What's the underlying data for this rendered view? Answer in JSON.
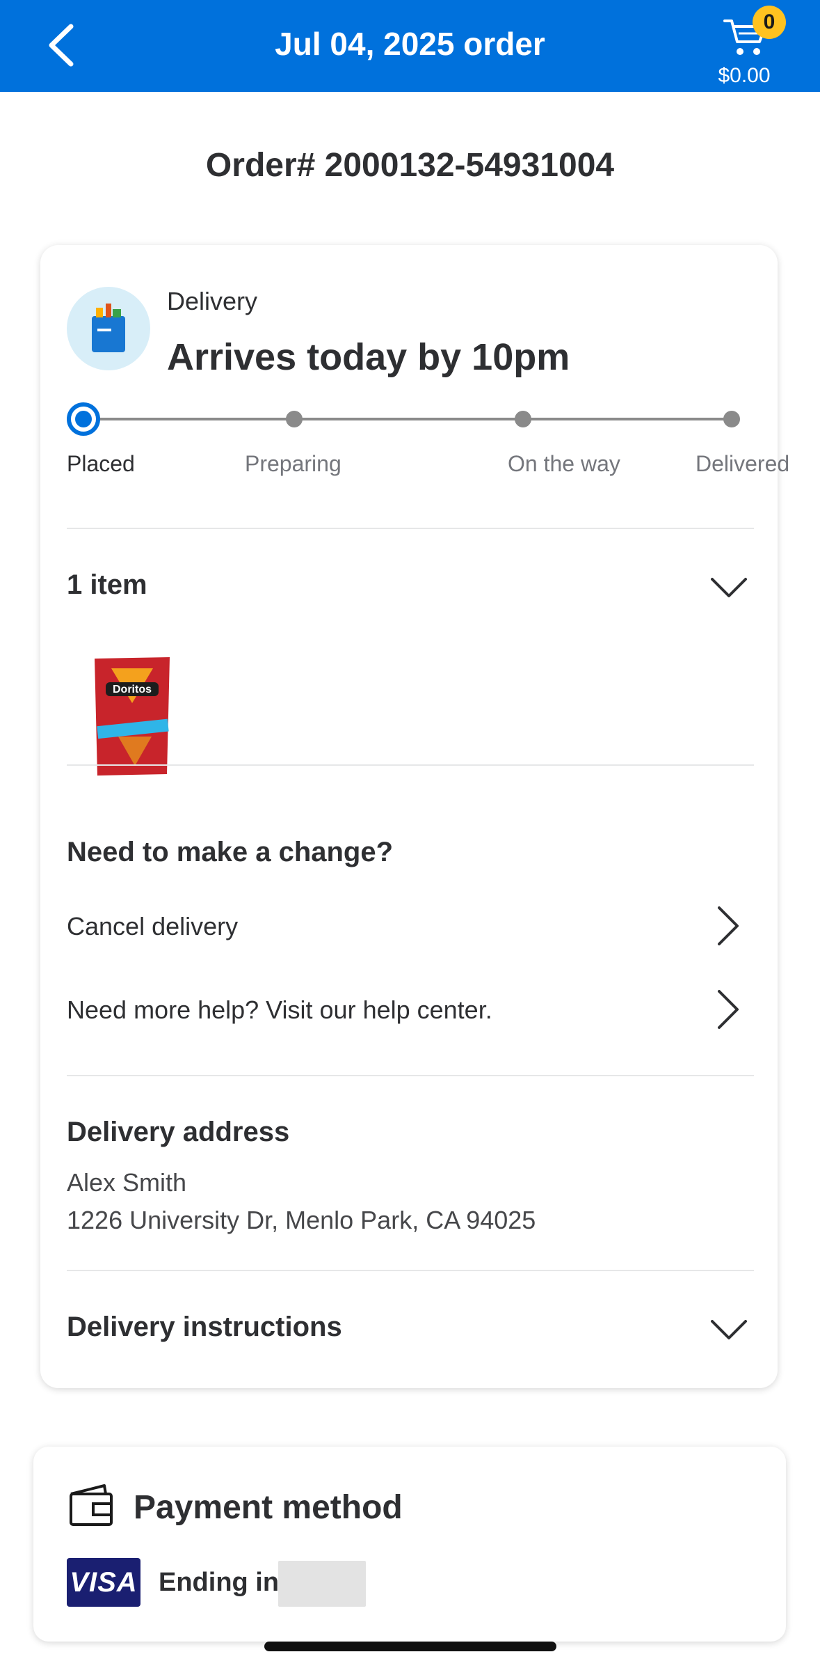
{
  "header": {
    "title": "Jul 04, 2025 order",
    "cart_count": "0",
    "cart_total": "$0.00",
    "color": "#0071dc"
  },
  "order_number": "Order# 2000132-54931004",
  "delivery": {
    "type": "Delivery",
    "arrival": "Arrives today by 10pm",
    "steps": [
      "Placed",
      "Preparing",
      "On the way",
      "Delivered"
    ],
    "current_step": "Placed"
  },
  "items": {
    "title": "1 item",
    "product_image": "doritos-nacho-cheese-bag"
  },
  "change": {
    "title": "Need to make a change?",
    "cancel_label": "Cancel delivery",
    "help_label": "Need more help? Visit our help center."
  },
  "address": {
    "title": "Delivery address",
    "name": "Alex Smith",
    "street": "1226 University Dr, Menlo Park, CA 94025"
  },
  "instructions": {
    "title": "Delivery instructions"
  },
  "payment": {
    "title": "Payment method",
    "card_brand": "VISA",
    "ending_label": "Ending in"
  },
  "icons": {
    "back": "chevron-left-icon",
    "cart": "cart-icon",
    "expand": "chevron-down-icon",
    "navigate": "chevron-right-icon",
    "wallet": "wallet-icon"
  }
}
